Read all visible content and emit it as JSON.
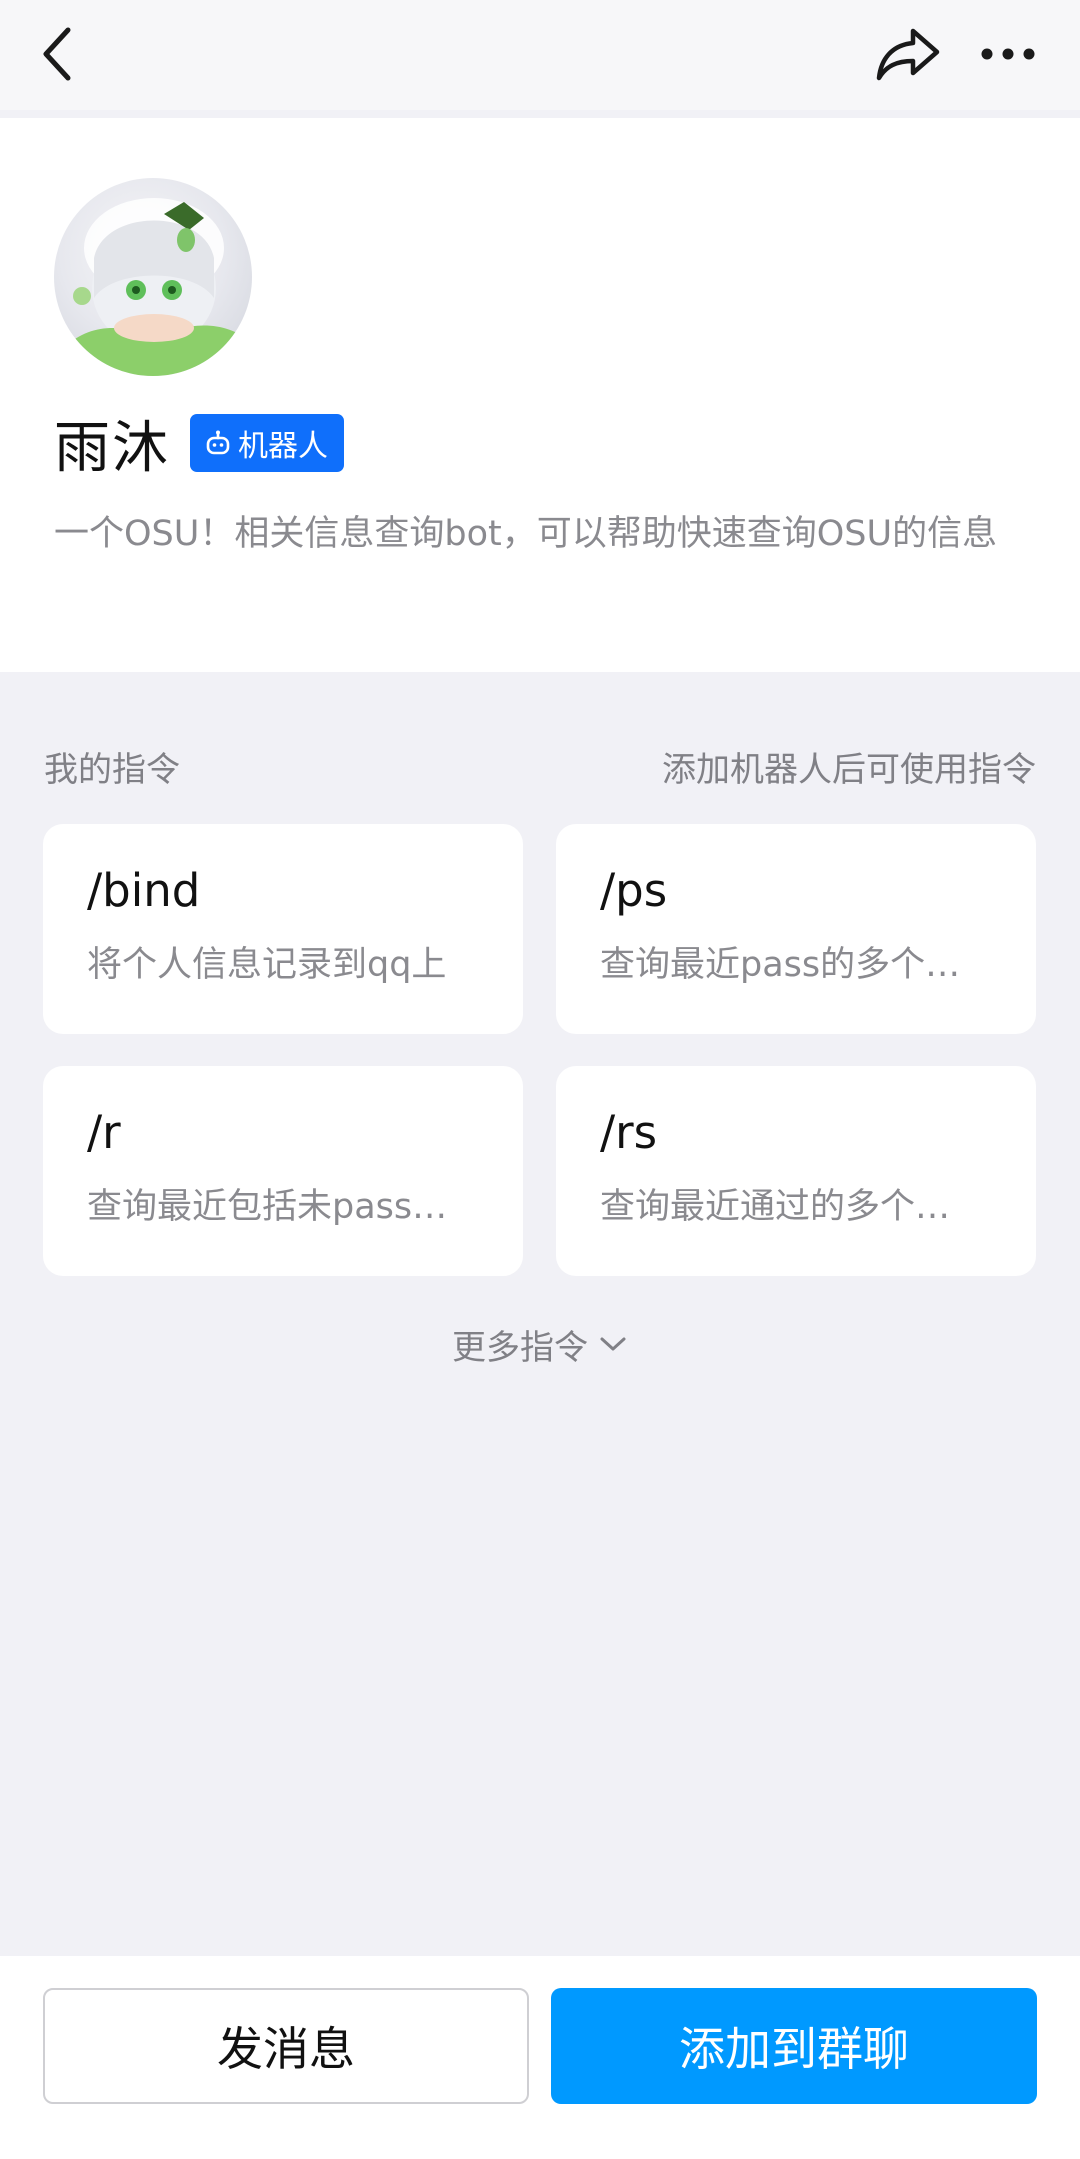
{
  "nav": {
    "back_icon": "chevron-left-icon",
    "share_icon": "share-icon",
    "more_icon": "more-dots-icon"
  },
  "profile": {
    "name": "雨沐",
    "badge_label": "机器人",
    "badge_icon": "robot-icon",
    "badge_color": "#0f6ffb",
    "description": "一个OSU！相关信息查询bot，可以帮助快速查询OSU的信息"
  },
  "commands": {
    "section_title": "我的指令",
    "hint": "添加机器人后可使用指令",
    "items": [
      {
        "name": "/bind",
        "desc": "将个人信息记录到qq上"
      },
      {
        "name": "/ps",
        "desc": "查询最近pass的多个…"
      },
      {
        "name": "/r",
        "desc": "查询最近包括未pass…"
      },
      {
        "name": "/rs",
        "desc": "查询最近通过的多个…"
      }
    ],
    "more_label": "更多指令"
  },
  "actions": {
    "send_message": "发消息",
    "add_to_group": "添加到群聊",
    "accent_color": "#0099ff"
  }
}
